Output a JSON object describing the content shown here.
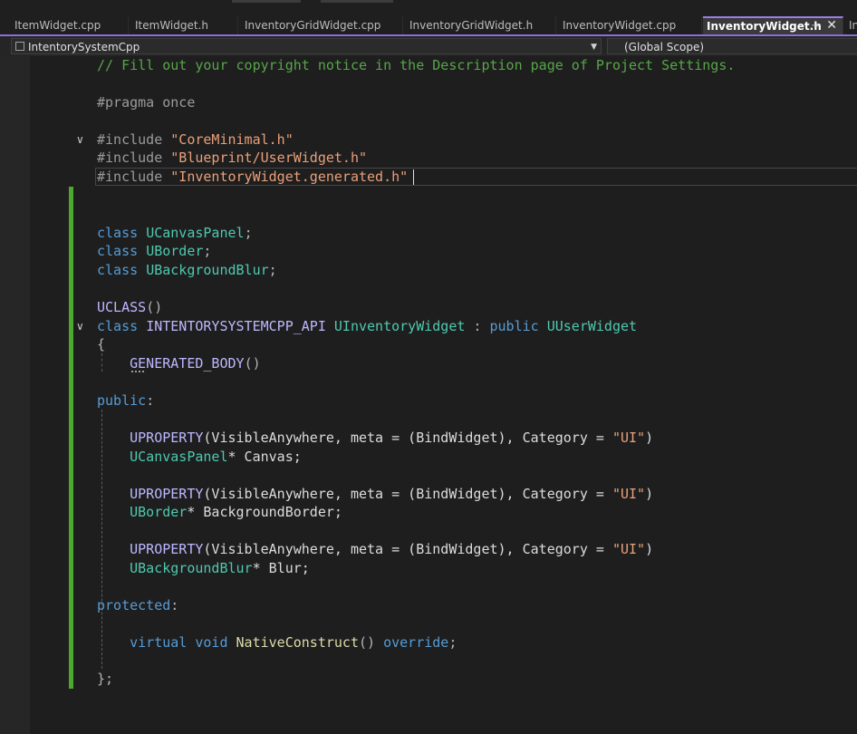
{
  "tabs": [
    {
      "label": "ItemWidget.cpp"
    },
    {
      "label": "ItemWidget.h"
    },
    {
      "label": "InventoryGridWidget.cpp"
    },
    {
      "label": "InventoryGridWidget.h"
    },
    {
      "label": "InventoryWidget.cpp"
    },
    {
      "label": "InventoryWidget.h",
      "active": true
    },
    {
      "label": "In"
    }
  ],
  "icons": {
    "pin": "pin-icon",
    "close": "close-icon",
    "project": "project-icon",
    "dropdown": "chevron-down-icon"
  },
  "navbar": {
    "project": "IntentorySystemCpp",
    "scope": "(Global Scope)"
  },
  "code": {
    "l1": "// Fill out your copyright notice in the Description page of Project Settings.",
    "pragma": "#pragma once",
    "inc": "#include",
    "inc1": "\"CoreMinimal.h\"",
    "inc2": "\"Blueprint/UserWidget.h\"",
    "inc3": "\"InventoryWidget.generated.h\"",
    "class": "class",
    "fwd1": "UCanvasPanel",
    "fwd2": "UBorder",
    "fwd3": "UBackgroundBlur",
    "semi": ";",
    "uclass": "UCLASS",
    "parens": "()",
    "api": "INTENTORYSYSTEMCPP_API",
    "name": "UInventoryWidget",
    "colon": " : ",
    "public": "public",
    "base": "UUserWidget",
    "open": "{",
    "genbody": "GENERATED_BODY",
    "public_label": "public",
    "protected_label": "protected",
    "label_colon": ":",
    "uprop": "UPROPERTY",
    "uprop_args_a": "(VisibleAnywhere, meta = (BindWidget), Category = ",
    "ui_str": "\"UI\"",
    "close_paren": ")",
    "canvas_type": "UCanvasPanel",
    "canvas_var": "* Canvas;",
    "border_type": "UBorder",
    "border_var": "* BackgroundBorder;",
    "blur_type": "UBackgroundBlur",
    "blur_var": "* Blur;",
    "virtual": "virtual",
    "void": "void",
    "native": "NativeConstruct",
    "override": "override",
    "close": "};"
  },
  "colors": {
    "comment": "#57a64a",
    "string": "#e8a07a",
    "keyword": "#569cd6",
    "type": "#4ec9b0",
    "macro": "#beb7ff",
    "function": "#dcdcaa",
    "change_bar": "#4ea72e",
    "active_tab_accent": "#9d7ee8"
  }
}
